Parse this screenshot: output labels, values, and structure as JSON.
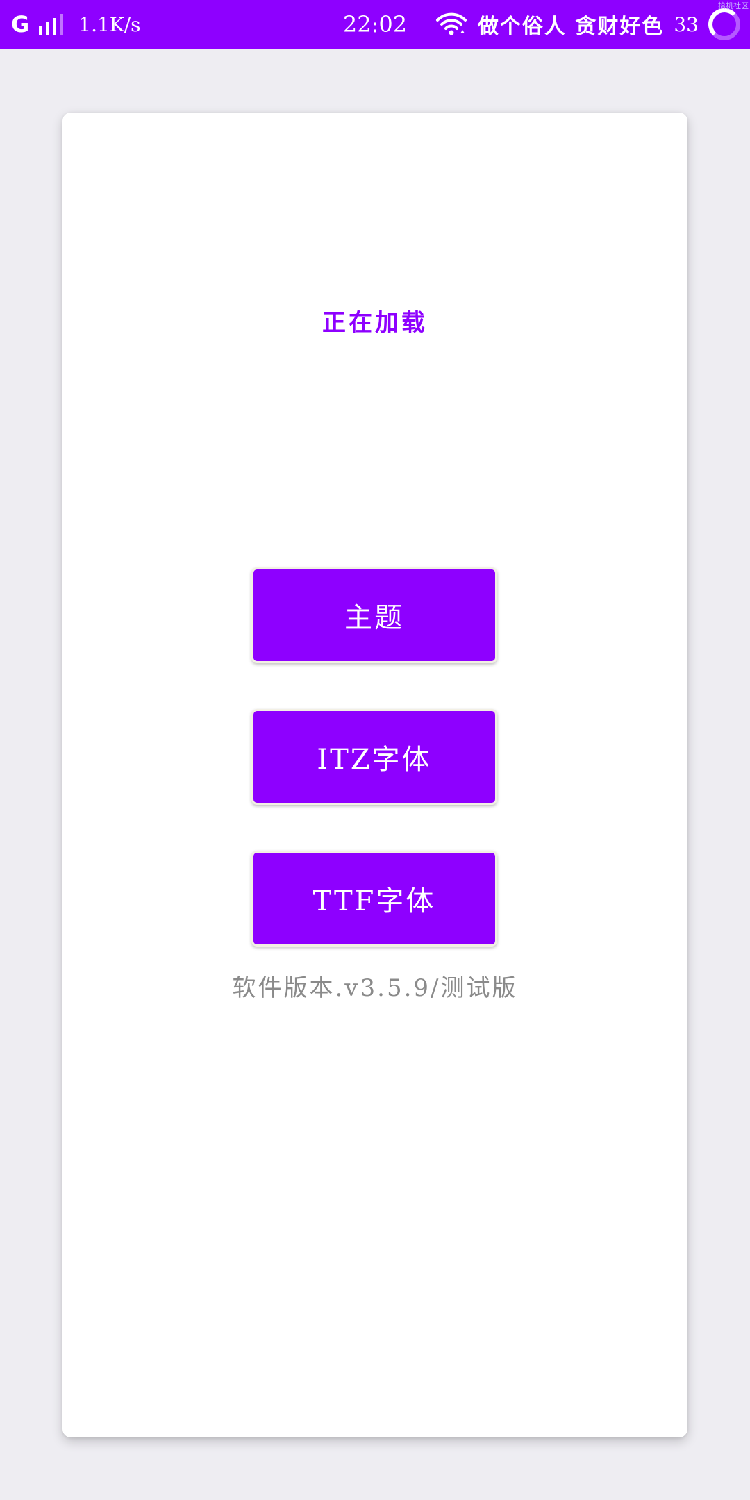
{
  "status_bar": {
    "network_type": "G",
    "net_speed": "1.1K/s",
    "time": "22:02",
    "carrier": "做个俗人 贪财好色",
    "battery_level": "33",
    "watermark": "搞机社区"
  },
  "card": {
    "loading_text": "正在加载",
    "buttons": {
      "theme": "主题",
      "itz_font": "ITZ字体",
      "ttf_font": "TTF字体"
    },
    "version": "软件版本.v3.5.9/测试版"
  },
  "colors": {
    "accent": "#8e00ff",
    "background": "#eeedf2",
    "card": "#ffffff",
    "version_text": "#8a8a8a"
  }
}
